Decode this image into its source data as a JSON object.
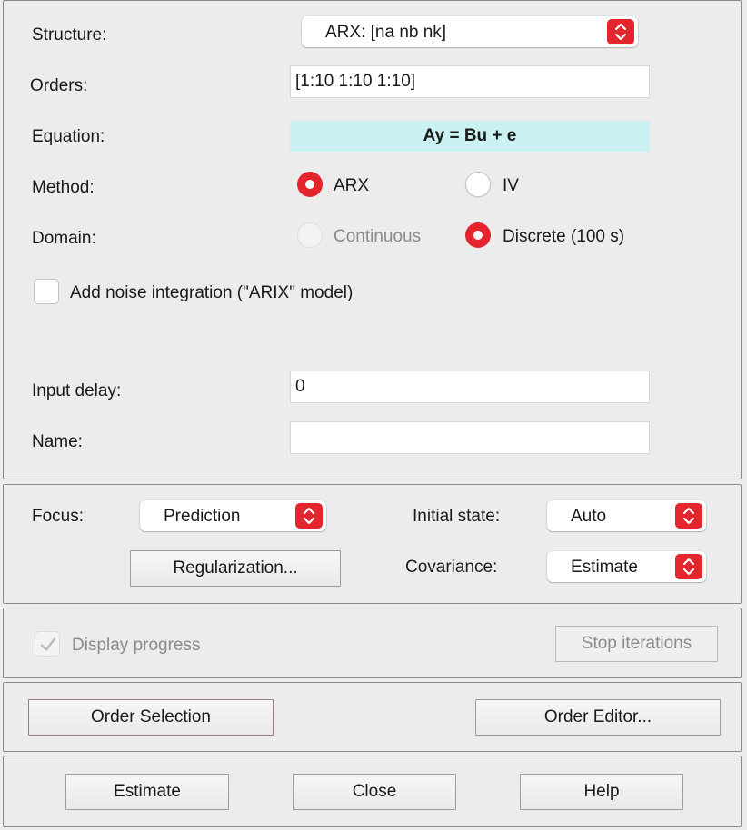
{
  "structure": {
    "label": "Structure:",
    "value": "ARX: [na nb nk]"
  },
  "orders": {
    "label": "Orders:",
    "value": "[1:10 1:10 1:10]"
  },
  "equation": {
    "label": "Equation:",
    "value": "Ay = Bu + e"
  },
  "method": {
    "label": "Method:",
    "options": [
      {
        "label": "ARX",
        "selected": true
      },
      {
        "label": "IV",
        "selected": false
      }
    ]
  },
  "domain": {
    "label": "Domain:",
    "options": [
      {
        "label": "Continuous",
        "selected": false,
        "enabled": false
      },
      {
        "label": "Discrete (100 s)",
        "selected": true,
        "enabled": true
      }
    ]
  },
  "noise_integration": {
    "label": "Add noise integration (\"ARIX\" model)",
    "checked": false
  },
  "input_delay": {
    "label": "Input delay:",
    "value": "0"
  },
  "name": {
    "label": "Name:",
    "value": ""
  },
  "focus": {
    "label": "Focus:",
    "value": "Prediction"
  },
  "regularization_label": "Regularization...",
  "initial_state": {
    "label": "Initial state:",
    "value": "Auto"
  },
  "covariance": {
    "label": "Covariance:",
    "value": "Estimate"
  },
  "display_progress": {
    "label": "Display progress",
    "checked": true,
    "enabled": false
  },
  "stop_iterations_label": "Stop iterations",
  "order_selection_label": "Order Selection",
  "order_editor_label": "Order Editor...",
  "estimate_label": "Estimate",
  "close_label": "Close",
  "help_label": "Help",
  "colors": {
    "accent": "#e5252d",
    "equation_bg": "#cbf2f2",
    "window_bg": "#ececec"
  }
}
